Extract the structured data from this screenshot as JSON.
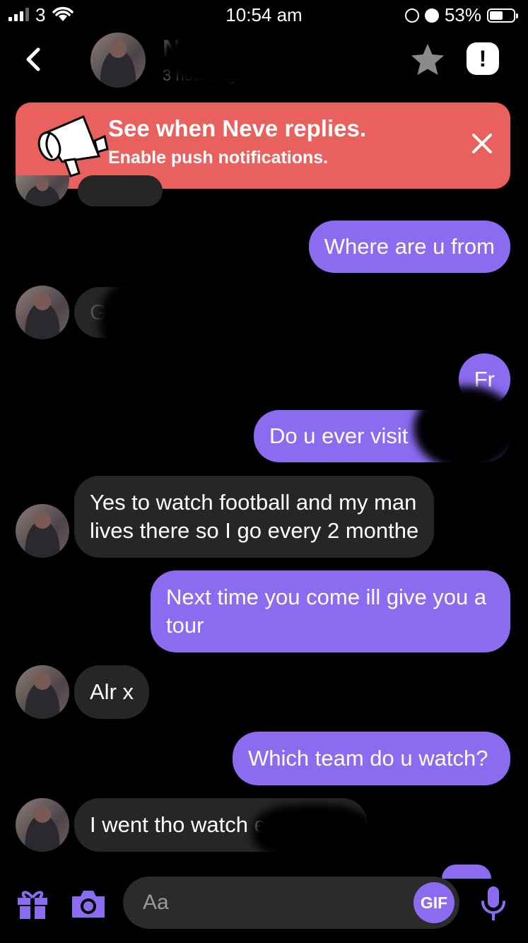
{
  "status_bar": {
    "carrier": "3",
    "time": "10:54 am",
    "battery": "53%",
    "icons": [
      "signal-icon",
      "wifi-icon",
      "orientation-lock-icon",
      "alarm-icon",
      "battery-icon"
    ]
  },
  "header": {
    "contact_name": "Neve",
    "last_seen": "3 hours ago",
    "icons": [
      "back-chevron-icon",
      "star-icon",
      "report-icon"
    ]
  },
  "banner": {
    "title": "See when Neve replies.",
    "subtitle": "Enable push notifications.",
    "bg_color": "#e9615f"
  },
  "messages": [
    {
      "side": "out",
      "text": "Where are u from"
    },
    {
      "side": "in",
      "text": "G"
    },
    {
      "side": "out",
      "text": "Fr"
    },
    {
      "side": "out",
      "text": "Do u ever visit"
    },
    {
      "side": "in",
      "lines": [
        "Yes to watch football and my man",
        "lives there so I go every 2 monthe"
      ]
    },
    {
      "side": "out",
      "lines": [
        "Next time you come ill give you a",
        "tour"
      ]
    },
    {
      "side": "in",
      "text": "Alr x"
    },
    {
      "side": "out",
      "text": "Which team do u watch?"
    },
    {
      "side": "in",
      "text": "I went tho watch engerland"
    }
  ],
  "composer": {
    "placeholder": "Aa",
    "gif_label": "GIF",
    "icons": [
      "gift-icon",
      "camera-icon",
      "microphone-icon"
    ]
  },
  "colors": {
    "accent": "#8b6cf1",
    "incoming_bubble": "#262626",
    "background": "#000000"
  }
}
